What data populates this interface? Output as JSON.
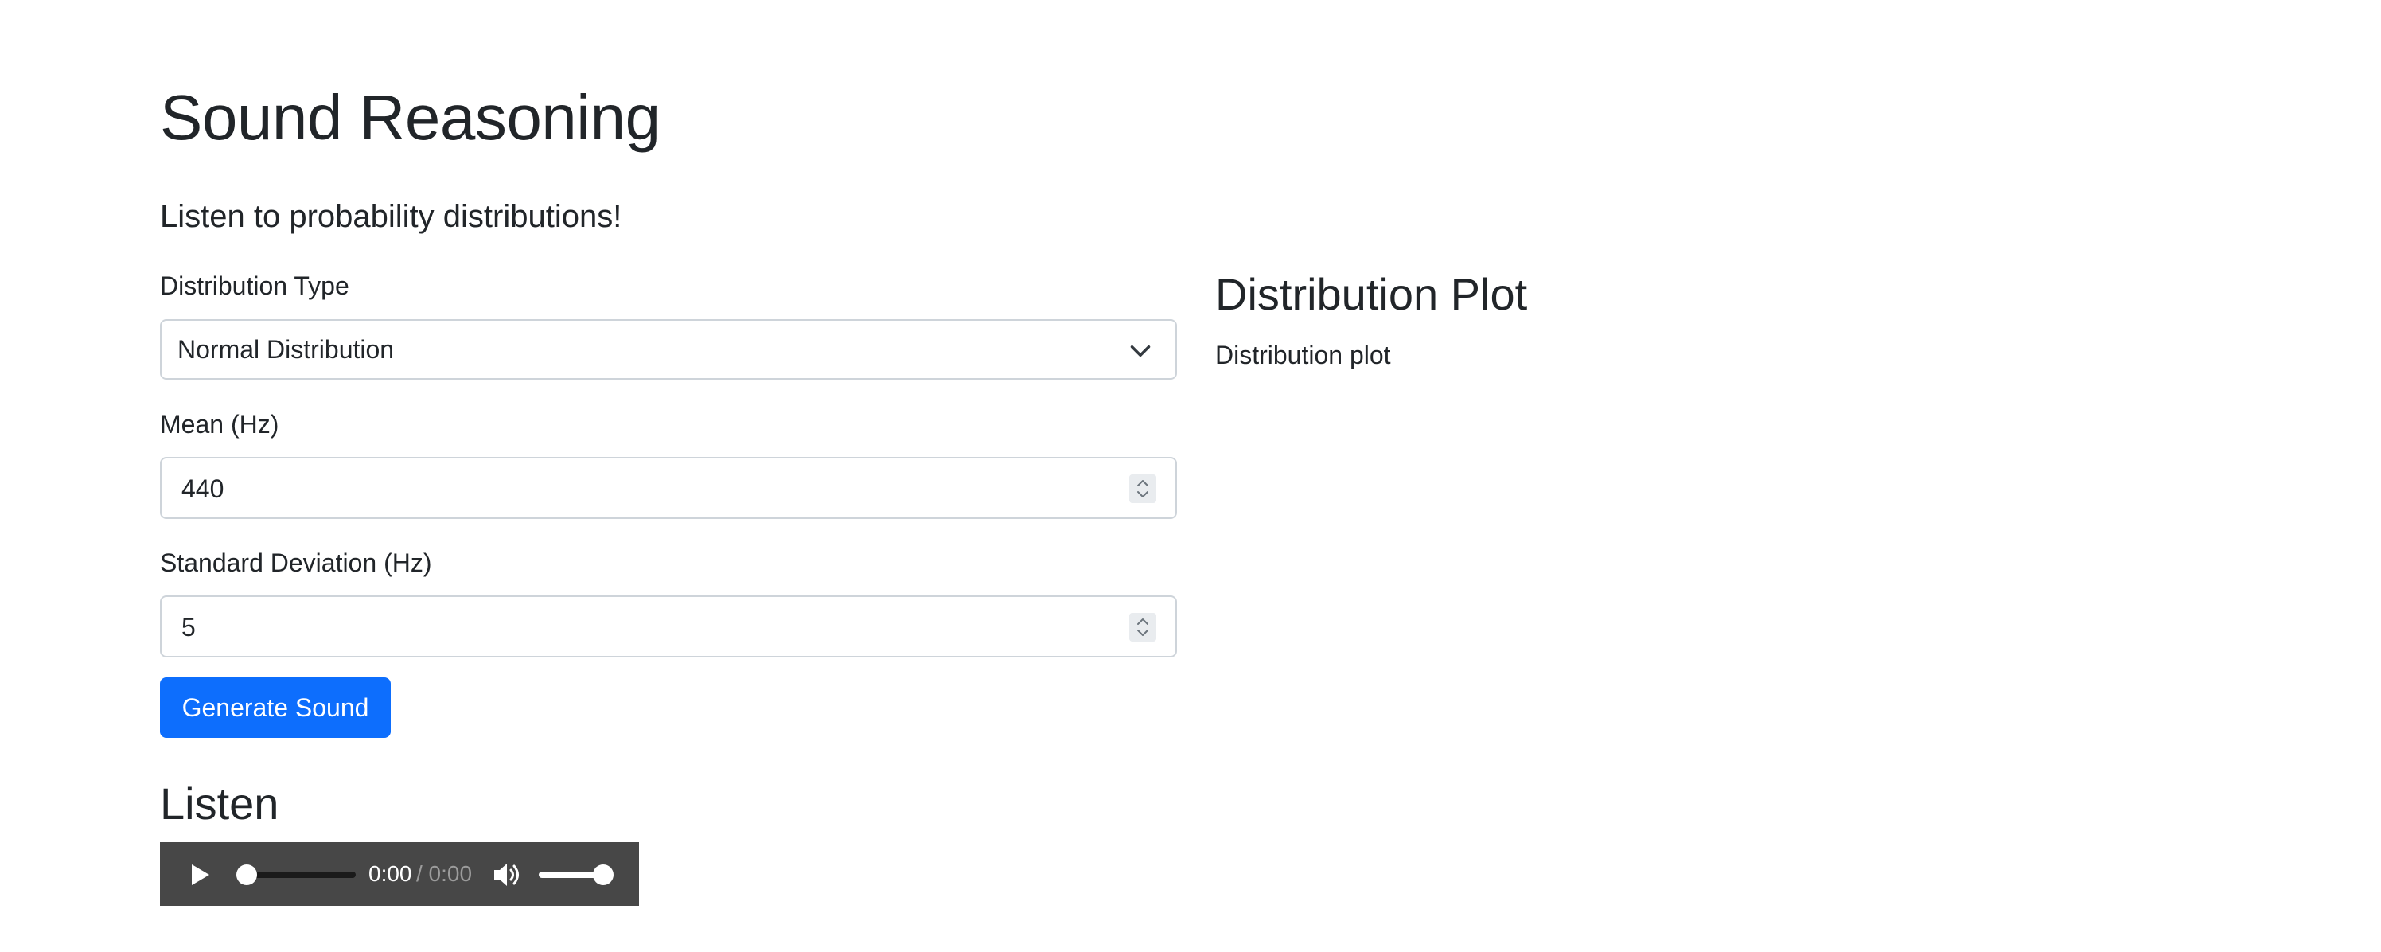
{
  "header": {
    "title": "Sound Reasoning",
    "lead": "Listen to probability distributions!"
  },
  "form": {
    "distribution_type": {
      "label": "Distribution Type",
      "selected": "Normal Distribution"
    },
    "mean": {
      "label": "Mean (Hz)",
      "value": "440"
    },
    "std_dev": {
      "label": "Standard Deviation (Hz)",
      "value": "5"
    },
    "generate_button": "Generate Sound"
  },
  "listen": {
    "heading": "Listen",
    "player": {
      "current_time": "0:00",
      "duration_text": "/ 0:00",
      "progress": 0,
      "volume": 1.0,
      "play_icon": "play-icon",
      "volume_icon": "volume-icon"
    }
  },
  "plot": {
    "heading": "Distribution Plot",
    "image_alt": "Distribution plot"
  },
  "colors": {
    "primary": "#0d6efd",
    "text": "#212529",
    "border": "#ced4da",
    "player_bg": "#474747"
  }
}
